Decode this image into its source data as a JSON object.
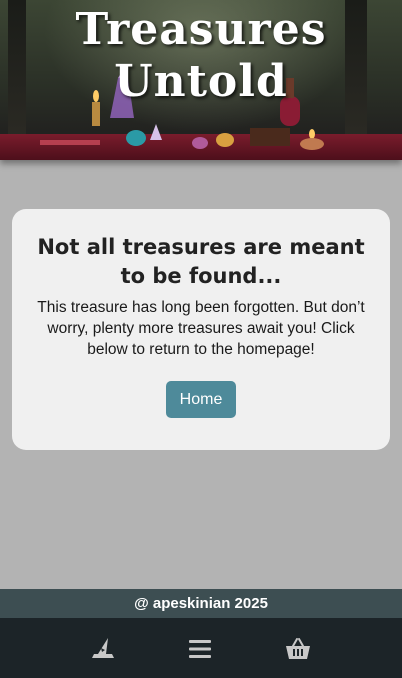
{
  "header": {
    "title_line1": "Treasures",
    "title_line2": "Untold"
  },
  "card": {
    "heading": "Not all treasures are meant to be found...",
    "message": "This treasure has long been forgotten. But don’t worry, plenty more treasures await you! Click below to return to the homepage!",
    "home_button_label": "Home"
  },
  "footer": {
    "copyright": "@ apeskinian 2025"
  },
  "nav": {
    "icons": [
      "wizard-hat-icon",
      "menu-icon",
      "basket-icon"
    ]
  },
  "colors": {
    "background": "#b3b3b3",
    "card": "#f0f0f0",
    "button": "#4e8a9a",
    "footer_strip": "#3d4e52",
    "navbar": "#1c2428",
    "icon": "#c8c8c8"
  }
}
